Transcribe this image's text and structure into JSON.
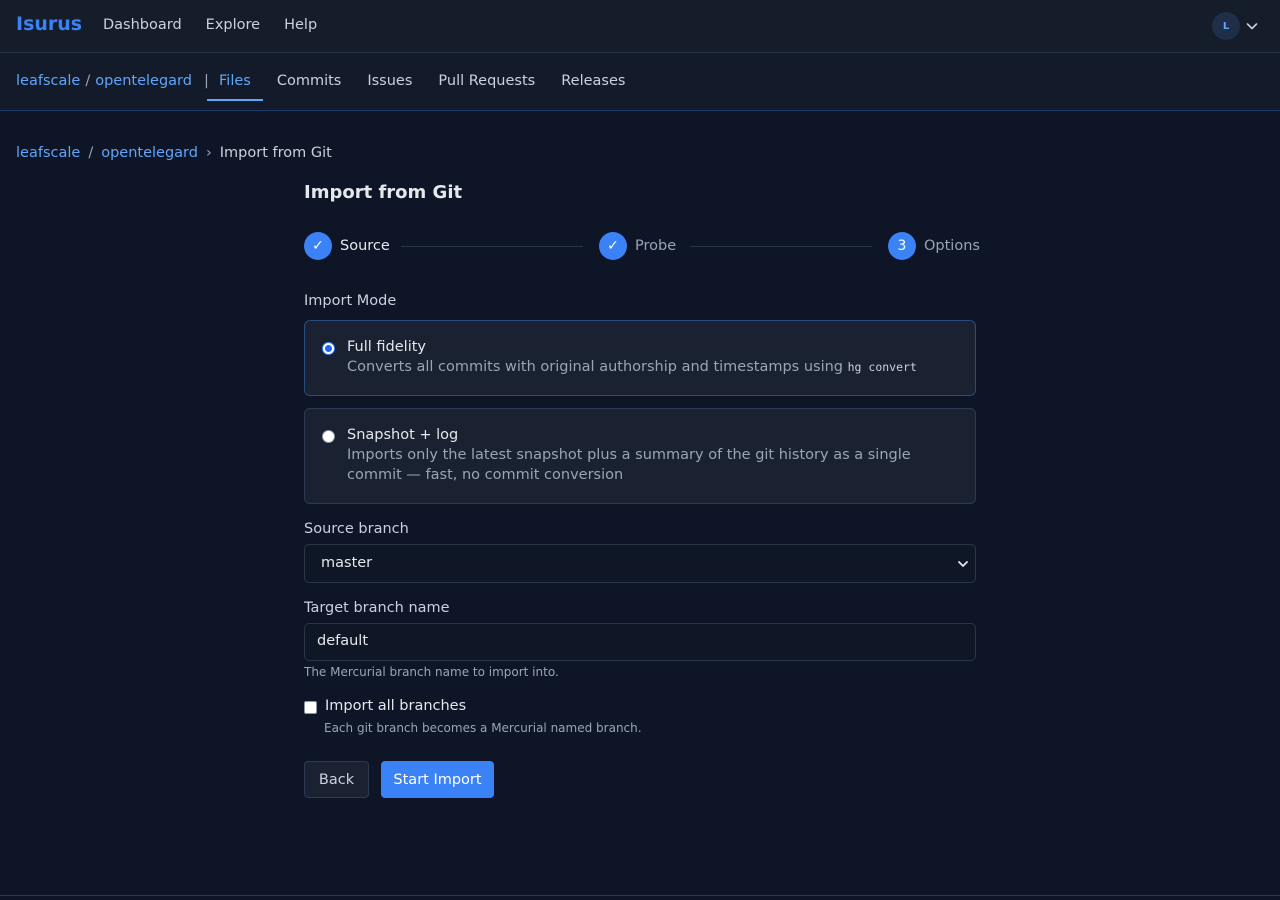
{
  "app": {
    "logo": "Isurus",
    "nav": [
      "Dashboard",
      "Explore",
      "Help"
    ],
    "user_initial": "L"
  },
  "repo": {
    "owner": "leafscale",
    "name": "opentelegard",
    "tabs": [
      "Files",
      "Commits",
      "Issues",
      "Pull Requests",
      "Releases"
    ],
    "active_tab": "Files"
  },
  "breadcrumb": {
    "owner": "leafscale",
    "repo": "opentelegard",
    "current": "Import from Git"
  },
  "page": {
    "title": "Import from Git",
    "steps": [
      {
        "marker": "✓",
        "label": "Source"
      },
      {
        "marker": "✓",
        "label": "Probe"
      },
      {
        "marker": "3",
        "label": "Options"
      }
    ],
    "import_mode_label": "Import Mode",
    "modes": [
      {
        "title": "Full fidelity",
        "desc": "Converts all commits with original authorship and timestamps using",
        "code": "hg convert",
        "selected": true
      },
      {
        "title": "Snapshot + log",
        "desc": "Imports only the latest snapshot plus a summary of the git history as a single commit — fast, no commit conversion",
        "selected": false
      }
    ],
    "source_branch_label": "Source branch",
    "source_branch_value": "master",
    "target_branch_label": "Target branch name",
    "target_branch_value": "default",
    "target_branch_hint": "The Mercurial branch name to import into.",
    "import_all_label": "Import all branches",
    "import_all_checked": false,
    "import_all_hint": "Each git branch becomes a Mercurial named branch.",
    "back_label": "Back",
    "start_label": "Start Import"
  },
  "colors": {
    "accent": "#3b82f6",
    "background": "#0d1526",
    "panel": "#1a2232"
  }
}
